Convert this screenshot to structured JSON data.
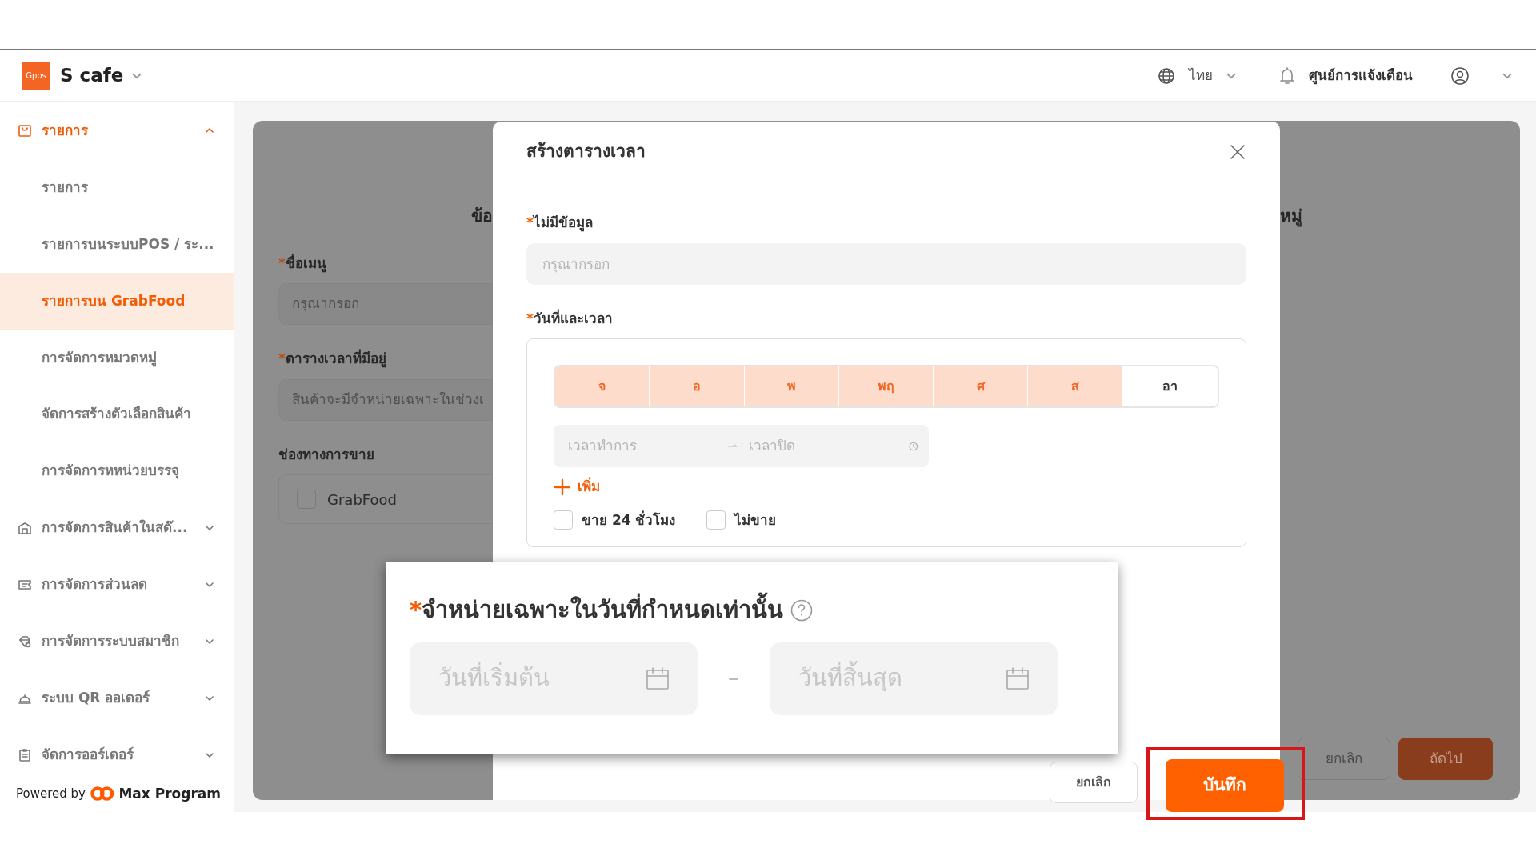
{
  "header": {
    "logo": "Gpos",
    "store": "S cafe",
    "language": "ไทย",
    "notifications": "ศูนย์การแจ้งเตือน"
  },
  "sidebar": {
    "groups": [
      {
        "label": "รายการ",
        "active": true,
        "expanded": true,
        "children": [
          {
            "label": "รายการ",
            "selected": false
          },
          {
            "label": "รายการบนระบบPOS / ระ...",
            "selected": false
          },
          {
            "label": "รายการบน GrabFood",
            "selected": true
          },
          {
            "label": "การจัดการหมวดหมู่",
            "selected": false
          },
          {
            "label": "จัดการสร้างตัวเลือกสินค้า",
            "selected": false
          },
          {
            "label": "การจัดการหหน่วยบรรจุ",
            "selected": false
          }
        ]
      },
      {
        "label": "การจัดการสินค้าในสต๊...",
        "active": false,
        "expanded": false
      },
      {
        "label": "การจัดการส่วนลด",
        "active": false,
        "expanded": false
      },
      {
        "label": "การจัดการระบบสมาชิก",
        "active": false,
        "expanded": false
      },
      {
        "label": "ระบบ QR ออเดอร์",
        "active": false,
        "expanded": false
      },
      {
        "label": "จัดการออร์เดอร์",
        "active": false,
        "expanded": false
      }
    ],
    "powered_by": "Powered by",
    "brand": "Max Program"
  },
  "page": {
    "heading_left": "ข้อ",
    "heading_right": "หมู่",
    "fields": [
      {
        "kind": "input",
        "mark": "*",
        "label": "ชื่อเมนู",
        "placeholder": "กรุณากรอก"
      },
      {
        "kind": "input",
        "mark": "*",
        "label": "ตารางเวลาที่มีอยู่",
        "placeholder": "สินค้าจะมีจำหน่ายเฉพาะในช่วงเ"
      },
      {
        "kind": "checkbox",
        "label": "ช่องทางการขาย",
        "option": "GrabFood",
        "checked": false
      }
    ],
    "buttons": [
      {
        "label": "ยกเลิก",
        "primary": false
      },
      {
        "label": "ถัดไป",
        "primary": true
      }
    ]
  },
  "modal": {
    "title": "สร้างตารางเวลา",
    "name_mark": "*",
    "name_label": "ไม่มีข้อมูล",
    "name_placeholder": "กรุณากรอก",
    "schedule_mark": "*",
    "schedule_label": "วันที่และเวลา",
    "days": [
      {
        "label": "จ",
        "selected": true
      },
      {
        "label": "อ",
        "selected": true
      },
      {
        "label": "พ",
        "selected": true
      },
      {
        "label": "พฤ",
        "selected": true
      },
      {
        "label": "ศ",
        "selected": true
      },
      {
        "label": "ส",
        "selected": true
      },
      {
        "label": "อา",
        "selected": false
      }
    ],
    "open_placeholder": "เวลาทำการ",
    "close_placeholder": "เวลาปิด",
    "add": "เพิ่ม",
    "options": [
      {
        "label": "ขาย 24 ชั่วโมง",
        "checked": false
      },
      {
        "label": "ไม่ขาย",
        "checked": false
      }
    ],
    "cancel": "ยกเลิก",
    "save": "บันทึก",
    "save_highlighted": true
  },
  "callout": {
    "mark": "*",
    "label": "จำหน่ายเฉพาะในวันที่กำหนดเท่านั้น",
    "start_placeholder": "วันที่เริ่มต้น",
    "separator": "–",
    "end_placeholder": "วันที่สิ้นสุด"
  }
}
